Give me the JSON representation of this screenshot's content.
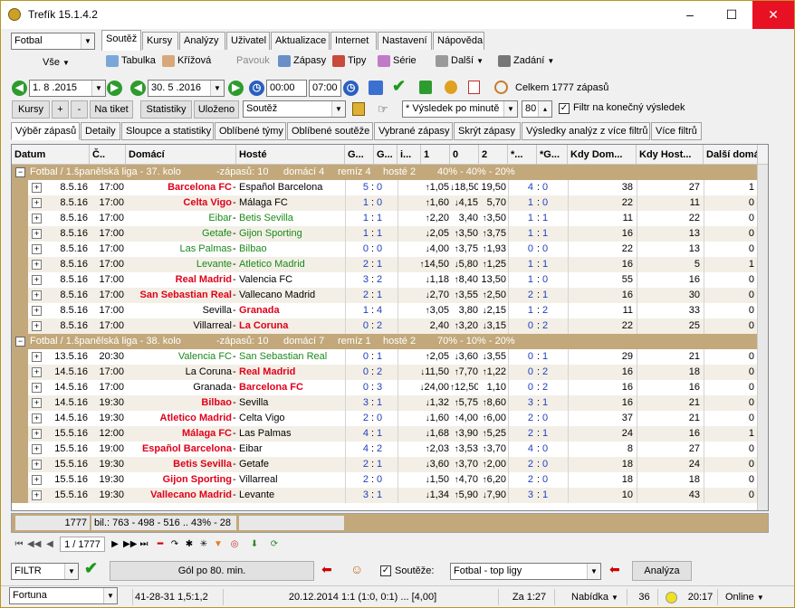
{
  "window": {
    "title": "Trefík 15.1.4.2",
    "min": "–",
    "max": "☐",
    "close": "✕"
  },
  "sport_select": "Fotbal",
  "filter_all": "Vše",
  "menu_tabs": [
    "Soutěž",
    "Kursy",
    "Analýzy",
    "Uživatel",
    "Aktualizace",
    "Internet",
    "Nastavení",
    "Nápověda"
  ],
  "toolbar": {
    "tabulka": "Tabulka",
    "krizova": "Křížová",
    "pavouk": "Pavouk",
    "zapasy": "Zápasy",
    "tipy": "Tipy",
    "serie": "Série",
    "dalsi": "Další",
    "zadani": "Zadání"
  },
  "date_bar": {
    "date_from": "1. 8 .2015",
    "date_to": "30. 5 .2016",
    "time_from": "00:00",
    "time_to": "07:00",
    "total": "Celkem 1777 zápasů"
  },
  "bar3": {
    "kursy": "Kursy",
    "plus": "+",
    "minus": "-",
    "na_tiket": "Na tiket",
    "statistiky": "Statistiky",
    "ulozeno": "Uloženo",
    "soutez": "Soutěž",
    "vysledek": "* Výsledek po minutě",
    "minuta": "80",
    "filtr_label": "Filtr na konečný výsledek"
  },
  "sub_tabs": [
    "Výběr zápasů",
    "Detaily",
    "Sloupce a statistiky",
    "Oblíbené týmy",
    "Oblíbené soutěže",
    "Vybrané zápasy",
    "Skrýt zápasy",
    "Výsledky analýz z více filtrů",
    "Více filtrů"
  ],
  "columns": [
    "Datum",
    "Č..",
    "Domácí",
    "Hosté",
    "G...",
    "G...",
    "i...",
    "1",
    "0",
    "2",
    "*...",
    "*G...",
    "Kdy Dom...",
    "Kdy Host...",
    "Další domácí"
  ],
  "groups": [
    {
      "title": "Fotbal / 1.španělská liga - 37. kolo",
      "zapasu": "-zápasů: 10",
      "domaci": "domácí 4",
      "remiza": "remíz 4",
      "hoste": "hosté 2",
      "pct": "40% - 40% - 20%",
      "rows": [
        {
          "d": "8.5.16",
          "t": "17:00",
          "h": "Barcelona FC",
          "hc": "red",
          "a": "Español Barcelona",
          "ac": "",
          "g1": "5",
          "g2": "0",
          "o1": "1,05",
          "o1a": "↑",
          "o0": "18,50",
          "o0a": "↓",
          "o2": "19,50",
          "o2a": "",
          "h1": "4",
          "h2": "0",
          "kd": "38",
          "kh": "27",
          "dd": "1"
        },
        {
          "d": "8.5.16",
          "t": "17:00",
          "h": "Celta Vigo",
          "hc": "red",
          "a": "Málaga FC",
          "ac": "",
          "g1": "1",
          "g2": "0",
          "o1": "1,60",
          "o1a": "↑",
          "o0": "4,15",
          "o0a": "↓",
          "o2": "5,70",
          "o2a": "",
          "h1": "1",
          "h2": "0",
          "kd": "22",
          "kh": "11",
          "dd": "0"
        },
        {
          "d": "8.5.16",
          "t": "17:00",
          "h": "Eibar",
          "hc": "grn",
          "a": "Betis Sevilla",
          "ac": "grn",
          "g1": "1",
          "g2": "1",
          "o1": "2,20",
          "o1a": "↑",
          "o0": "3,40",
          "o0a": "",
          "o2": "3,50",
          "o2a": "↑",
          "h1": "1",
          "h2": "1",
          "kd": "11",
          "kh": "22",
          "dd": "0"
        },
        {
          "d": "8.5.16",
          "t": "17:00",
          "h": "Getafe",
          "hc": "grn",
          "a": "Gijon Sporting",
          "ac": "grn",
          "g1": "1",
          "g2": "1",
          "o1": "2,05",
          "o1a": "↓",
          "o0": "3,50",
          "o0a": "↑",
          "o2": "3,75",
          "o2a": "↑",
          "h1": "1",
          "h2": "1",
          "kd": "16",
          "kh": "13",
          "dd": "0"
        },
        {
          "d": "8.5.16",
          "t": "17:00",
          "h": "Las Palmas",
          "hc": "grn",
          "a": "Bilbao",
          "ac": "grn",
          "g1": "0",
          "g2": "0",
          "o1": "4,00",
          "o1a": "↓",
          "o0": "3,75",
          "o0a": "↑",
          "o2": "1,93",
          "o2a": "↑",
          "h1": "0",
          "h2": "0",
          "kd": "22",
          "kh": "13",
          "dd": "0"
        },
        {
          "d": "8.5.16",
          "t": "17:00",
          "h": "Levante",
          "hc": "grn",
          "a": "Atletico Madrid",
          "ac": "grn",
          "g1": "2",
          "g2": "1",
          "o1": "14,50",
          "o1a": "↑",
          "o0": "5,80",
          "o0a": "↓",
          "o2": "1,25",
          "o2a": "↑",
          "h1": "1",
          "h2": "1",
          "kd": "16",
          "kh": "5",
          "dd": "1"
        },
        {
          "d": "8.5.16",
          "t": "17:00",
          "h": "Real Madrid",
          "hc": "red",
          "a": "Valencia FC",
          "ac": "",
          "g1": "3",
          "g2": "2",
          "o1": "1,18",
          "o1a": "↓",
          "o0": "8,40",
          "o0a": "↑",
          "o2": "13,50",
          "o2a": "",
          "h1": "1",
          "h2": "0",
          "kd": "55",
          "kh": "16",
          "dd": "0"
        },
        {
          "d": "8.5.16",
          "t": "17:00",
          "h": "San Sebastian Real",
          "hc": "red",
          "a": "Vallecano Madrid",
          "ac": "",
          "g1": "2",
          "g2": "1",
          "o1": "2,70",
          "o1a": "↓",
          "o0": "3,55",
          "o0a": "↑",
          "o2": "2,50",
          "o2a": "↑",
          "h1": "2",
          "h2": "1",
          "kd": "16",
          "kh": "30",
          "dd": "0"
        },
        {
          "d": "8.5.16",
          "t": "17:00",
          "h": "Sevilla",
          "hc": "",
          "a": "Granada",
          "ac": "red",
          "g1": "1",
          "g2": "4",
          "o1": "3,05",
          "o1a": "↑",
          "o0": "3,80",
          "o0a": "",
          "o2": "2,15",
          "o2a": "↓",
          "h1": "1",
          "h2": "2",
          "kd": "11",
          "kh": "33",
          "dd": "0"
        },
        {
          "d": "8.5.16",
          "t": "17:00",
          "h": "Villarreal",
          "hc": "",
          "a": "La Coruna",
          "ac": "red",
          "g1": "0",
          "g2": "2",
          "o1": "2,40",
          "o1a": "",
          "o0": "3,20",
          "o0a": "↑",
          "o2": "3,15",
          "o2a": "↓",
          "h1": "0",
          "h2": "2",
          "kd": "22",
          "kh": "25",
          "dd": "0"
        }
      ]
    },
    {
      "title": "Fotbal / 1.španělská liga - 38. kolo",
      "zapasu": "-zápasů: 10",
      "domaci": "domácí 7",
      "remiza": "remíz 1",
      "hoste": "hosté 2",
      "pct": "70% - 10% - 20%",
      "rows": [
        {
          "d": "13.5.16",
          "t": "20:30",
          "h": "Valencia FC",
          "hc": "grn",
          "a": "San Sebastian Real",
          "ac": "grn",
          "g1": "0",
          "g2": "1",
          "o1": "2,05",
          "o1a": "↑",
          "o0": "3,60",
          "o0a": "↓",
          "o2": "3,55",
          "o2a": "↓",
          "h1": "0",
          "h2": "1",
          "kd": "29",
          "kh": "21",
          "dd": "0"
        },
        {
          "d": "14.5.16",
          "t": "17:00",
          "h": "La Coruna",
          "hc": "",
          "a": "Real Madrid",
          "ac": "red",
          "g1": "0",
          "g2": "2",
          "o1": "11,50",
          "o1a": "↓",
          "o0": "7,70",
          "o0a": "↑",
          "o2": "1,22",
          "o2a": "↑",
          "h1": "0",
          "h2": "2",
          "kd": "16",
          "kh": "18",
          "dd": "0"
        },
        {
          "d": "14.5.16",
          "t": "17:00",
          "h": "Granada",
          "hc": "",
          "a": "Barcelona FC",
          "ac": "red",
          "g1": "0",
          "g2": "3",
          "o1": "24,00",
          "o1a": "↓",
          "o0": "12,50",
          "o0a": "↑",
          "o2": "1,10",
          "o2a": "",
          "h1": "0",
          "h2": "2",
          "kd": "16",
          "kh": "16",
          "dd": "0"
        },
        {
          "d": "14.5.16",
          "t": "19:30",
          "h": "Bilbao",
          "hc": "red",
          "a": "Sevilla",
          "ac": "",
          "g1": "3",
          "g2": "1",
          "o1": "1,32",
          "o1a": "↓",
          "o0": "5,75",
          "o0a": "↑",
          "o2": "8,60",
          "o2a": "↑",
          "h1": "3",
          "h2": "1",
          "kd": "16",
          "kh": "21",
          "dd": "0"
        },
        {
          "d": "14.5.16",
          "t": "19:30",
          "h": "Atletico Madrid",
          "hc": "red",
          "a": "Celta Vigo",
          "ac": "",
          "g1": "2",
          "g2": "0",
          "o1": "1,60",
          "o1a": "↓",
          "o0": "4,00",
          "o0a": "↑",
          "o2": "6,00",
          "o2a": "↑",
          "h1": "2",
          "h2": "0",
          "kd": "37",
          "kh": "21",
          "dd": "0"
        },
        {
          "d": "15.5.16",
          "t": "12:00",
          "h": "Málaga FC",
          "hc": "red",
          "a": "Las Palmas",
          "ac": "",
          "g1": "4",
          "g2": "1",
          "o1": "1,68",
          "o1a": "↓",
          "o0": "3,90",
          "o0a": "↑",
          "o2": "5,25",
          "o2a": "↑",
          "h1": "2",
          "h2": "1",
          "kd": "24",
          "kh": "16",
          "dd": "1"
        },
        {
          "d": "15.5.16",
          "t": "19:00",
          "h": "Español Barcelona",
          "hc": "red",
          "a": "Eibar",
          "ac": "",
          "g1": "4",
          "g2": "2",
          "o1": "2,03",
          "o1a": "↑",
          "o0": "3,53",
          "o0a": "↑",
          "o2": "3,70",
          "o2a": "↑",
          "h1": "4",
          "h2": "0",
          "kd": "8",
          "kh": "27",
          "dd": "0"
        },
        {
          "d": "15.5.16",
          "t": "19:30",
          "h": "Betis Sevilla",
          "hc": "red",
          "a": "Getafe",
          "ac": "",
          "g1": "2",
          "g2": "1",
          "o1": "3,60",
          "o1a": "↓",
          "o0": "3,70",
          "o0a": "↑",
          "o2": "2,00",
          "o2a": "↑",
          "h1": "2",
          "h2": "0",
          "kd": "18",
          "kh": "24",
          "dd": "0"
        },
        {
          "d": "15.5.16",
          "t": "19:30",
          "h": "Gijon Sporting",
          "hc": "red",
          "a": "Villarreal",
          "ac": "",
          "g1": "2",
          "g2": "0",
          "o1": "1,50",
          "o1a": "↓",
          "o0": "4,70",
          "o0a": "↑",
          "o2": "6,20",
          "o2a": "↑",
          "h1": "2",
          "h2": "0",
          "kd": "18",
          "kh": "18",
          "dd": "0"
        },
        {
          "d": "15.5.16",
          "t": "19:30",
          "h": "Vallecano Madrid",
          "hc": "red",
          "a": "Levante",
          "ac": "",
          "g1": "3",
          "g2": "1",
          "o1": "1,34",
          "o1a": "↓",
          "o0": "5,90",
          "o0a": "↑",
          "o2": "7,90",
          "o2a": "↓",
          "h1": "3",
          "h2": "1",
          "kd": "10",
          "kh": "43",
          "dd": "0"
        }
      ]
    }
  ],
  "summary": {
    "count": "1777",
    "stats": "bil.: 763 - 498 - 516 .. 43% - 28"
  },
  "nav": {
    "page": "1 / 1777"
  },
  "filter_bar": {
    "filtr": "FILTR",
    "gol": "Gól po 80. min.",
    "souteze_label": "Soutěže:",
    "souteze_value": "Fotbal - top ligy",
    "analyza": "Analýza"
  },
  "status": {
    "fortuna": "Fortuna",
    "score1": "41-28-31 1,5:1,2",
    "match": "20.12.2014 1:1 (1:0, 0:1) ... [4,00]",
    "za": "Za 1:27",
    "nabidka": "Nabídka",
    "num": "36",
    "time": "20:17",
    "online": "Online"
  }
}
